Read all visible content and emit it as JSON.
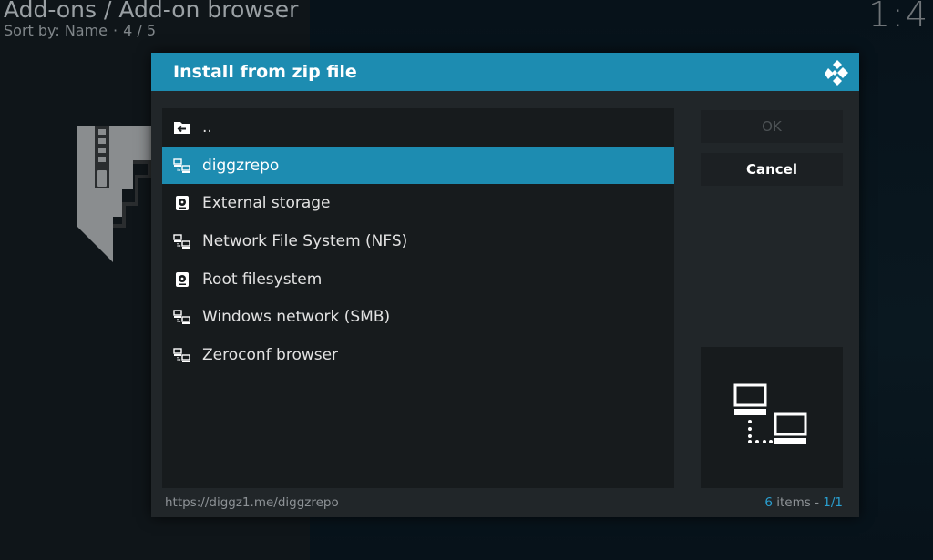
{
  "background": {
    "title": "Add-ons / Add-on browser",
    "sort_label": "Sort by: Name",
    "separator": "·",
    "position": "4 / 5",
    "clock": "1:4"
  },
  "dialog": {
    "title": "Install from zip file",
    "items": [
      {
        "label": "..",
        "icon": "back-folder-icon"
      },
      {
        "label": "diggzrepo",
        "icon": "network-icon",
        "selected": true
      },
      {
        "label": "External storage",
        "icon": "drive-icon"
      },
      {
        "label": "Network File System (NFS)",
        "icon": "network-icon"
      },
      {
        "label": "Root filesystem",
        "icon": "drive-icon"
      },
      {
        "label": "Windows network (SMB)",
        "icon": "network-icon"
      },
      {
        "label": "Zeroconf browser",
        "icon": "network-icon"
      }
    ],
    "ok_label": "OK",
    "cancel_label": "Cancel",
    "footer_path": "https://diggz1.me/diggzrepo",
    "count_num": "6",
    "count_text": "items",
    "count_sep": "-",
    "page": "1/1"
  },
  "colors": {
    "accent": "#1d8cb1",
    "dialog_bg": "#212629",
    "panel_bg": "#171b1d"
  }
}
